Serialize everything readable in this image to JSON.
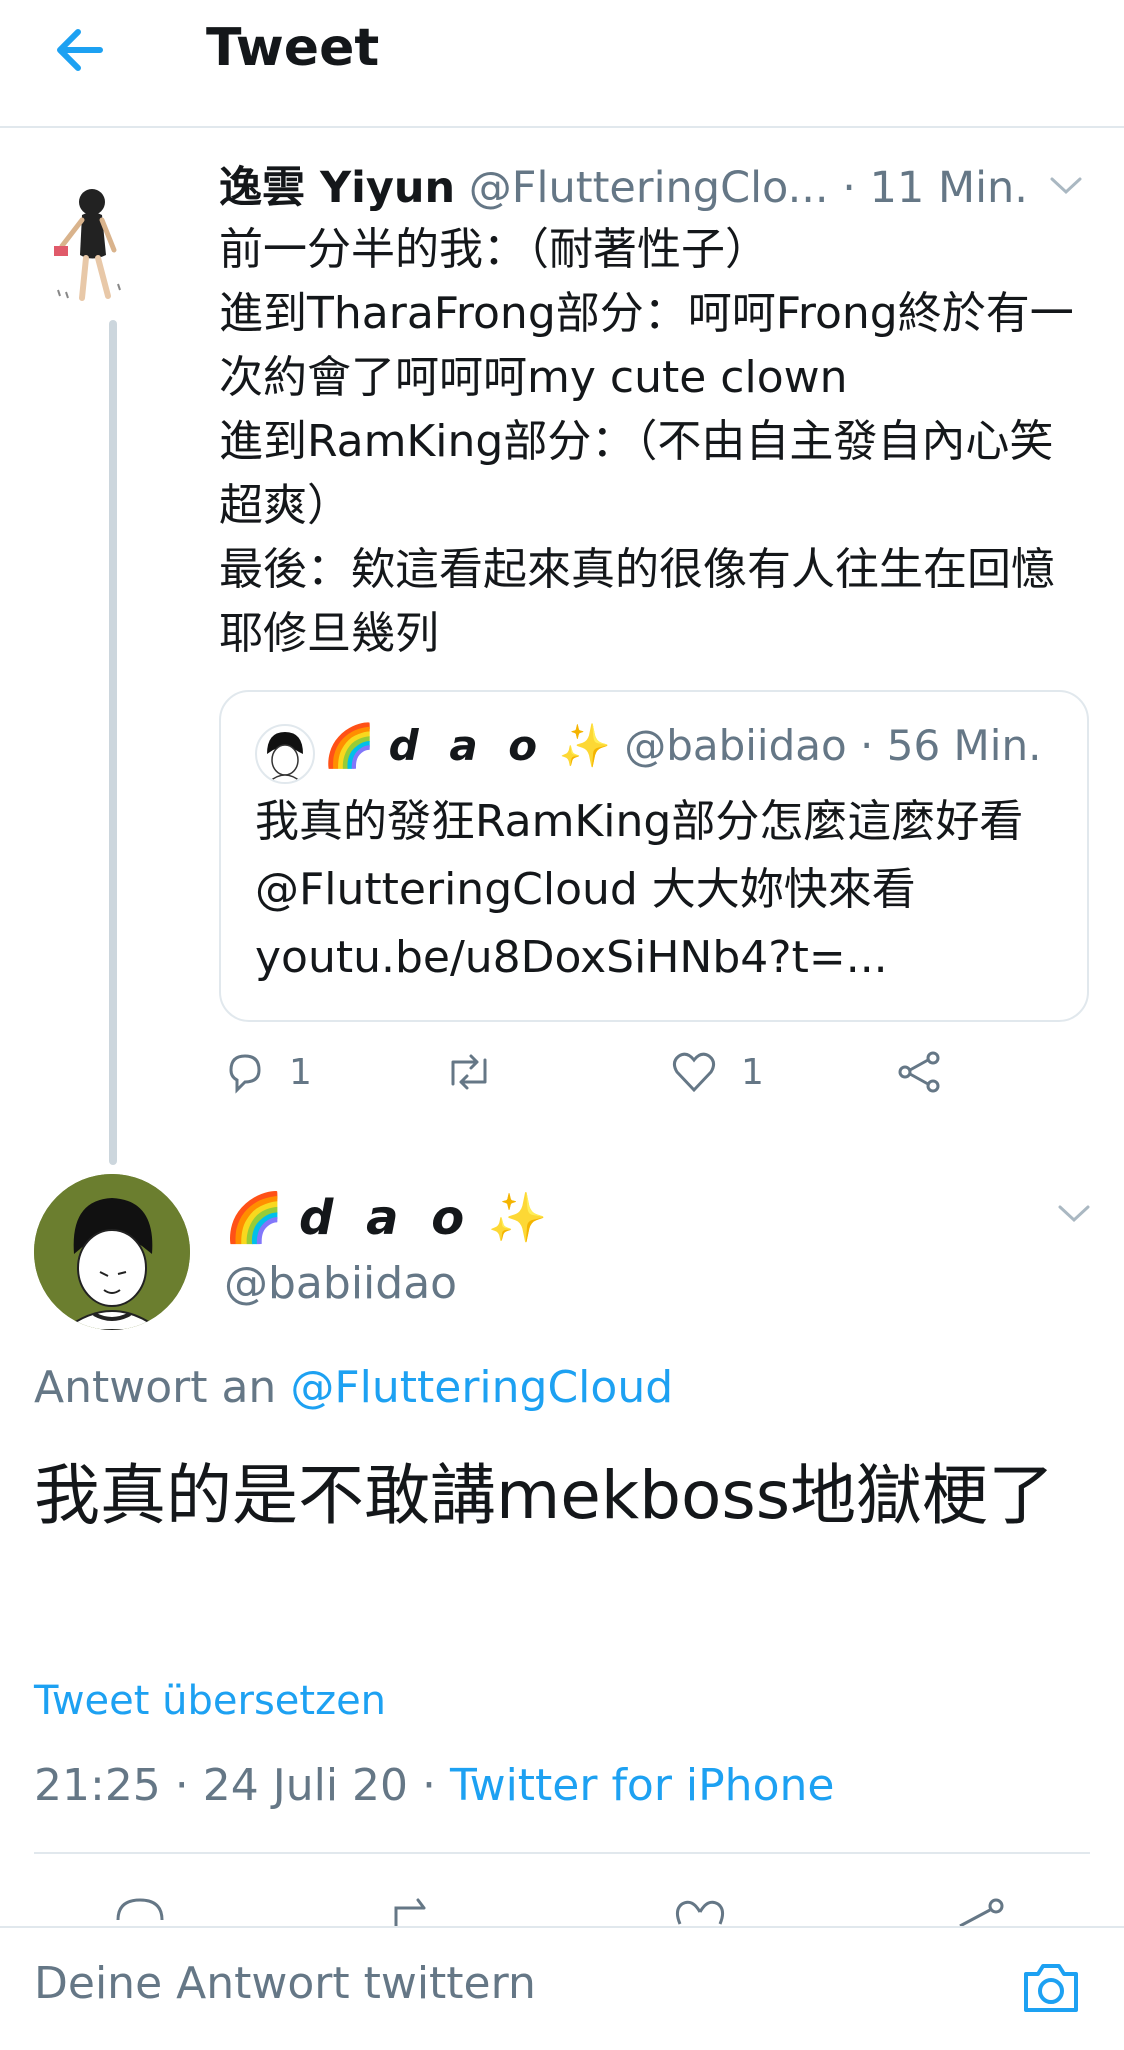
{
  "header": {
    "title": "Tweet"
  },
  "parent_tweet": {
    "name": "逸雲 Yiyun",
    "handle": "@FlutteringClo...",
    "time": "· 11 Min.",
    "text": "前一分半的我：（耐著性子）\n進到TharaFrong部分：呵呵Frong終於有一次約會了呵呵呵my cute clown\n進到RamKing部分：（不由自主發自內心笑超爽）\n最後：欸這看起來真的很像有人往生在回憶耶修旦幾列",
    "quote": {
      "name": "d a o",
      "handle": "@babiidao",
      "time": "· 56 Min.",
      "text": "我真的發狂RamKing部分怎麼這麼好看 @FlutteringCloud 大大妳快來看 youtu.be/u8DoxSiHNb4?t=..."
    },
    "reply_count": "1",
    "like_count": "1"
  },
  "main_tweet": {
    "name": "d a o",
    "handle": "@babiidao",
    "reply_prefix": "Antwort an",
    "reply_target": "@FlutteringCloud",
    "text": "我真的是不敢講mekboss地獄梗了",
    "translate": "Tweet übersetzen",
    "time": "21:25 · 24 Juli 20 · ",
    "source": "Twitter for iPhone"
  },
  "composer": {
    "placeholder": "Deine Antwort twittern"
  },
  "colors": {
    "accent": "#1da1f2",
    "grey": "#657786",
    "divider": "#e1e8ed"
  }
}
